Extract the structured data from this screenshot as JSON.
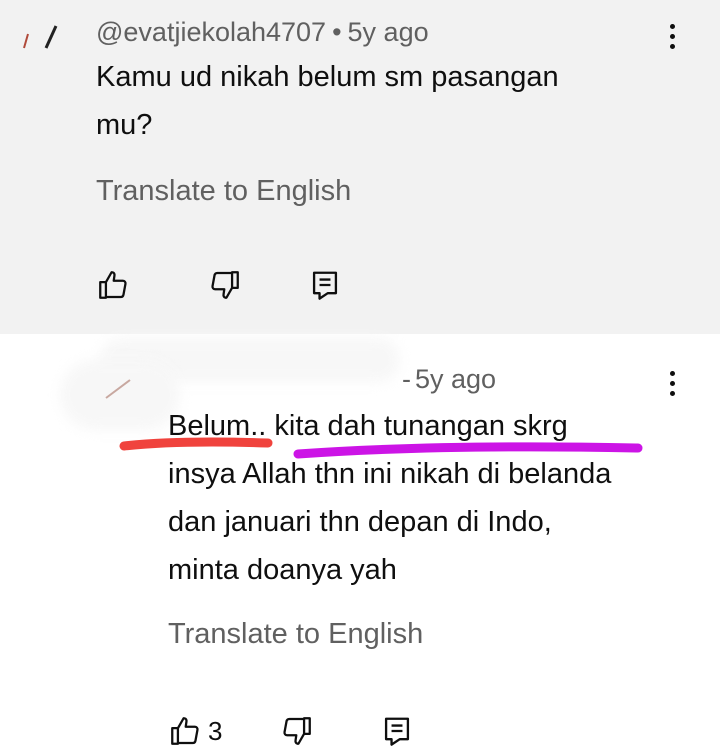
{
  "comments": [
    {
      "author": "@evatjiekolah4707",
      "time": "5y ago",
      "text_lines": [
        "Kamu ud nikah belum sm pasangan",
        "mu?"
      ],
      "translate": "Translate to English",
      "like_count": ""
    },
    {
      "author": "",
      "time": "5y ago",
      "text_lines": [
        "Belum.. kita dah tunangan skrg",
        "insya Allah thn ini nikah di belanda",
        "dan januari thn depan di Indo,",
        "minta doanya yah"
      ],
      "translate": "Translate to English",
      "like_count": "3"
    }
  ],
  "icons": {
    "like": "thumbs-up-icon",
    "dislike": "thumbs-down-icon",
    "reply": "reply-icon",
    "menu": "more-vert-icon"
  },
  "colors": {
    "highlight_red": "#f0433d",
    "highlight_purple": "#cc14e6"
  }
}
